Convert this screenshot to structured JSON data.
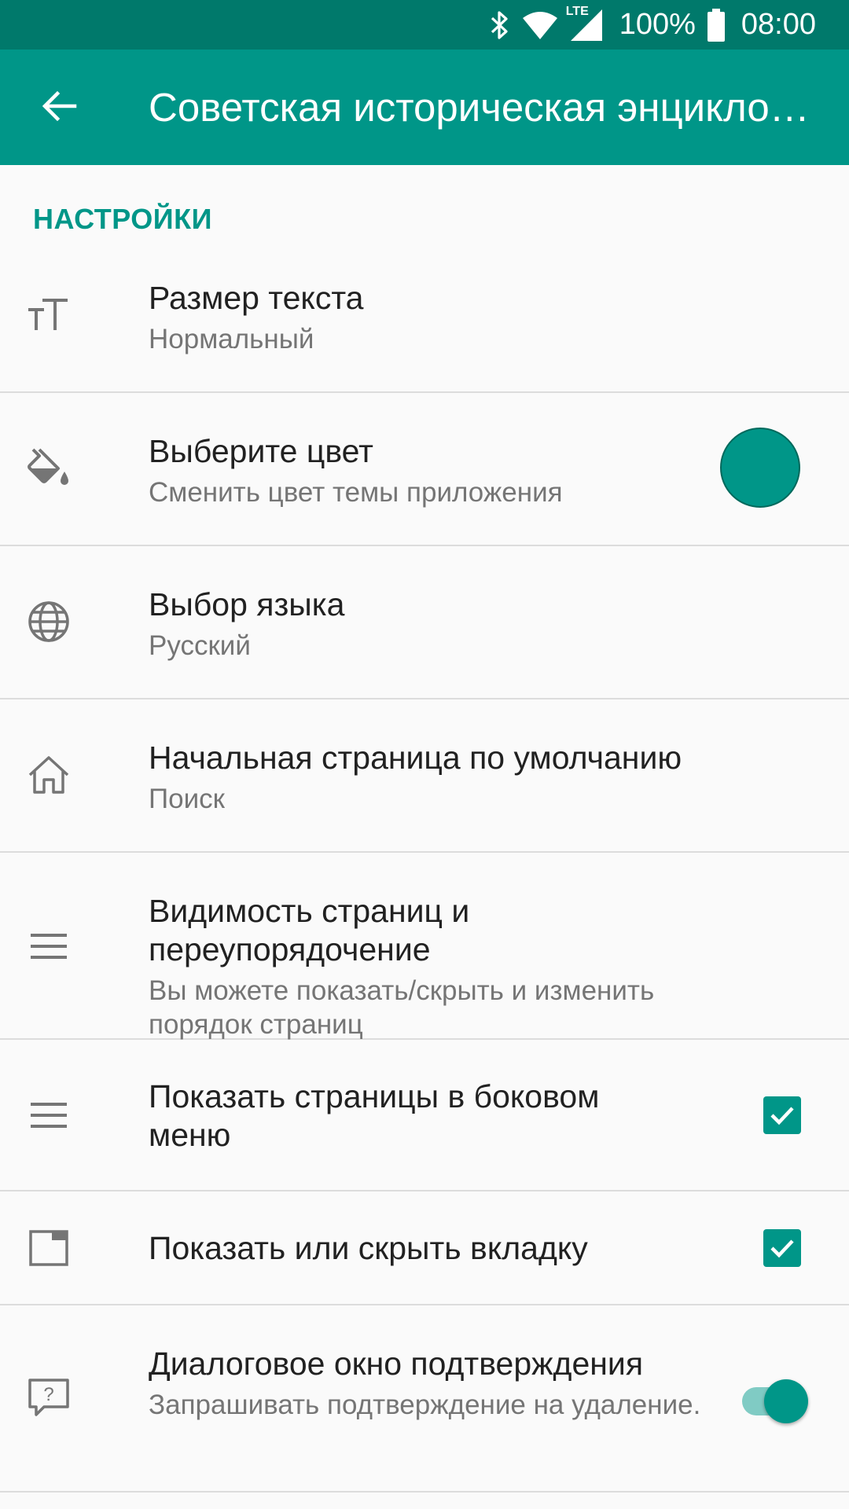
{
  "status_bar": {
    "network": "LTE",
    "battery": "100%",
    "time": "08:00"
  },
  "app_bar": {
    "title": "Советская историческая энциклопедия"
  },
  "settings": {
    "section_header": "НАСТРОЙКИ",
    "items": [
      {
        "title": "Размер текста",
        "summary": "Нормальный",
        "icon": "text-size-icon"
      },
      {
        "title": "Выберите цвет",
        "summary": "Сменить цвет темы приложения",
        "icon": "paint-bucket-icon",
        "value": "#009688"
      },
      {
        "title": "Выбор языка",
        "summary": "Русский",
        "icon": "globe-icon"
      },
      {
        "title": "Начальная страница по умолчанию",
        "summary": "Поиск",
        "icon": "home-icon"
      },
      {
        "title": "Видимость страниц и переупорядочение",
        "summary": "Вы можете показать/скрыть и изменить порядок страниц",
        "icon": "menu-icon"
      },
      {
        "title": "Показать страницы в боковом меню",
        "icon": "menu-icon",
        "checked": true
      },
      {
        "title": "Показать или скрыть вкладку",
        "icon": "tab-icon",
        "checked": true
      },
      {
        "title": "Диалоговое окно подтверждения",
        "summary": "Запрашивать подтверждение на удаление.",
        "icon": "help-dialog-icon",
        "enabled": true
      }
    ]
  },
  "colors": {
    "status_bar": "#00796b",
    "app_bar": "#009688",
    "accent": "#009688"
  }
}
